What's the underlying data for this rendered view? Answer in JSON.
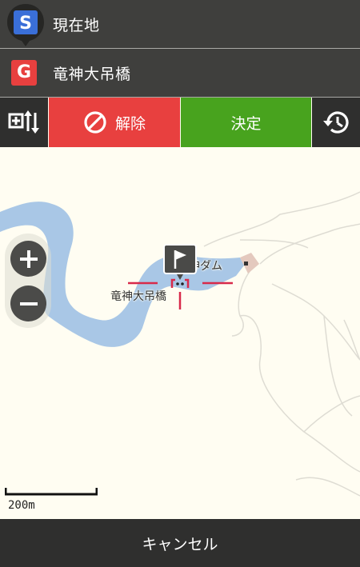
{
  "route": {
    "start": {
      "badge": "S",
      "label": "現在地"
    },
    "goal": {
      "badge": "G",
      "label": "竜神大吊橋"
    }
  },
  "toolbar": {
    "cancel_label": "解除",
    "confirm_label": "決定"
  },
  "map": {
    "labels": {
      "dam": "竜神ダム",
      "bridge": "竜神大吊橋"
    },
    "scale_label": "200m"
  },
  "footer": {
    "cancel_label": "キャンセル"
  },
  "colors": {
    "header_bg": "#3f3f3d",
    "cancel_red": "#e8403f",
    "confirm_green": "#48a31e",
    "water": "#a9c7e6",
    "map_bg": "#fffdf2",
    "start_badge_blue": "#3a6fd8"
  },
  "icons": [
    "start-pin-icon",
    "goal-badge-icon",
    "route-swap-icon",
    "prohibit-icon",
    "history-icon",
    "zoom-in-icon",
    "zoom-out-icon",
    "flag-icon",
    "crosshair-icon"
  ]
}
